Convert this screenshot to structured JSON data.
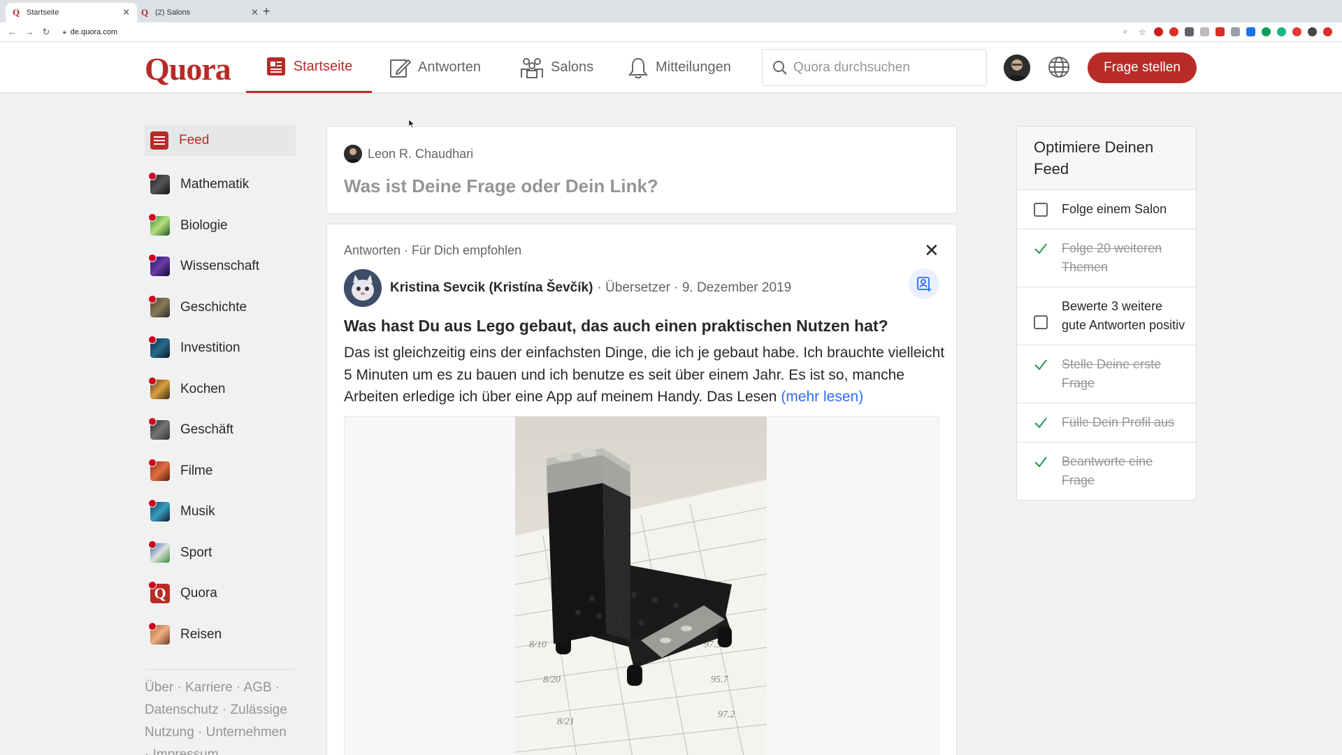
{
  "browser": {
    "tabs": [
      {
        "title": "Startseite",
        "active": true
      },
      {
        "title": "(2) Salons",
        "active": false
      }
    ],
    "url": "de.quora.com"
  },
  "header": {
    "logo": "Quora",
    "nav": [
      {
        "label": "Startseite",
        "icon": "home-feed-icon",
        "active": true
      },
      {
        "label": "Antworten",
        "icon": "pencil-answer-icon",
        "active": false
      },
      {
        "label": "Salons",
        "icon": "people-group-icon",
        "active": false
      },
      {
        "label": "Mitteilungen",
        "icon": "bell-icon",
        "active": false
      }
    ],
    "search_placeholder": "Quora durchsuchen",
    "ask_button": "Frage stellen",
    "accent_color": "#b92b27"
  },
  "sidebar": {
    "items": [
      {
        "label": "Feed",
        "active": true
      },
      {
        "label": "Mathematik"
      },
      {
        "label": "Biologie"
      },
      {
        "label": "Wissenschaft"
      },
      {
        "label": "Geschichte"
      },
      {
        "label": "Investition"
      },
      {
        "label": "Kochen"
      },
      {
        "label": "Geschäft"
      },
      {
        "label": "Filme"
      },
      {
        "label": "Musik"
      },
      {
        "label": "Sport"
      },
      {
        "label": "Quora"
      },
      {
        "label": "Reisen"
      }
    ],
    "footer_links": [
      "Über",
      "Karriere",
      "AGB",
      "Datenschutz",
      "Zulässige Nutzung",
      "Unternehmen",
      "Impressum"
    ]
  },
  "ask_box": {
    "user": "Leon R. Chaudhari",
    "prompt": "Was ist Deine Frage oder Dein Link?"
  },
  "feed_item": {
    "meta": "Antworten · Für Dich empfohlen",
    "author": "Kristina Sevcik (Kristína Ševčík)",
    "author_sub": "· Übersetzer · 9. Dezember 2019",
    "question": "Was hast Du aus Lego gebaut, das auch einen praktischen Nutzen hat?",
    "excerpt": "Das ist gleichzeitig eins der einfachsten Dinge, die ich je gebaut habe. Ich brauchte vielleicht 5 Minuten um es zu bauen und ich benutze es seit über einem Jahr. Es ist so, manche Arbeiten erledige ich über eine App auf meinem Handy. Das Lesen ",
    "more": "(mehr lesen)"
  },
  "optimize": {
    "title": "Optimiere Deinen Feed",
    "items": [
      {
        "label": "Folge einem Salon",
        "done": false
      },
      {
        "label": "Folge 20 weiteren Themen",
        "done": true
      },
      {
        "label": "Bewerte 3 weitere gute Antworten positiv",
        "done": false
      },
      {
        "label": "Stelle Deine erste Frage",
        "done": true
      },
      {
        "label": "Fülle Dein Profil aus",
        "done": true
      },
      {
        "label": "Beantworte eine Frage",
        "done": true
      }
    ]
  }
}
